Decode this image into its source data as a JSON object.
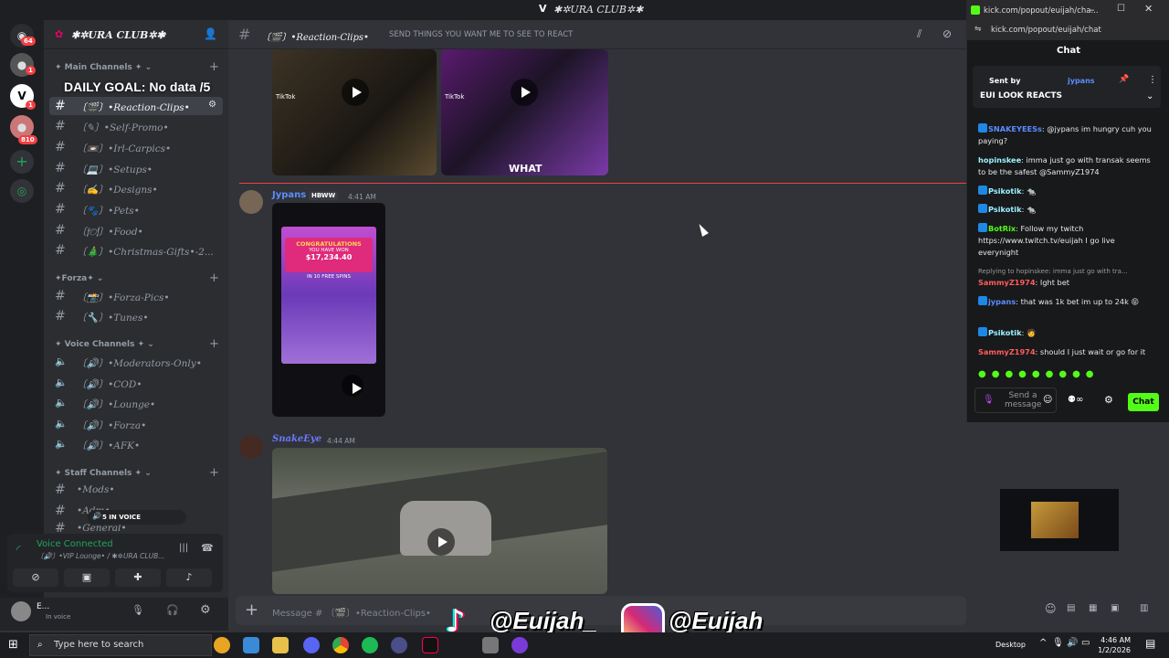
{
  "window": {
    "title": "✱✲URA CLUB✲✱"
  },
  "server": {
    "name": "✱✲URA CLUB✲✱",
    "rail_badges": [
      "64",
      "1",
      "1",
      "810"
    ]
  },
  "overlay": {
    "goal_text": "DAILY GOAL: No data  /5"
  },
  "categories": {
    "main": "✦ Main Channels ✦ ⌄",
    "forza": "✦Forza✦ ⌄",
    "voice": "✦ Voice Channels ✦ ⌄",
    "staff": "✦ Staff Channels ✦ ⌄"
  },
  "channels": [
    {
      "label": "〔🎬〕•Reaction-Clips•"
    },
    {
      "label": "〔✎〕•Self-Promo•"
    },
    {
      "label": "〔📼〕•Irl-Carpics•"
    },
    {
      "label": "〔💻〕•Setups•"
    },
    {
      "label": "〔✍〕•Designs•"
    },
    {
      "label": "〔🐾〕•Pets•"
    },
    {
      "label": "〔🍽〕•Food•"
    },
    {
      "label": "〔🎄〕•Christmas-Gifts•-2..."
    },
    {
      "label": "〔📸〕•Forza-Pics•"
    },
    {
      "label": "〔🔧〕•Tunes•"
    },
    {
      "label": "〔🔊〕•Moderators-Only•"
    },
    {
      "label": "〔🔊〕•COD•"
    },
    {
      "label": "〔🔊〕•Lounge•"
    },
    {
      "label": "〔🔊〕•Forza•"
    },
    {
      "label": "〔🔊〕•AFK•"
    },
    {
      "label": "•Mods•"
    },
    {
      "label": "•Adm•"
    },
    {
      "label": "•General•"
    }
  ],
  "voice": {
    "chip": "5 IN VOICE",
    "connected": "Voice Connected",
    "location": "〔🔊〕•VIP Lounge• / ✱✲URA CLUB...",
    "user_name": "E...",
    "user_status": "In voice"
  },
  "channel_header": {
    "name": "〔🎬〕•Reaction-Clips•",
    "topic": "SEND THINGS YOU WANT ME TO SEE TO REACT"
  },
  "messages": [
    {
      "author": "Jypans",
      "tag": "HBWW",
      "time": "4:41 AM",
      "image_text": [
        "CONGRATULATIONS",
        "YOU HAVE WON",
        "$17,234.40",
        "IN 10 FREE SPINS"
      ]
    },
    {
      "author": "SnakeEye",
      "time": "4:44 AM"
    }
  ],
  "top_clips": {
    "tiktok": "TikTok",
    "caption": "WHAT"
  },
  "message_input": {
    "placeholder": "Message # 〔🎬〕•Reaction-Clips•"
  },
  "social_overlay": {
    "tiktok": "@Euijah_",
    "instagram": "@Euijah"
  },
  "kick": {
    "window_title": "kick.com/popout/euijah/cha...",
    "url": "kick.com/popout/euijah/chat",
    "chat_title": "Chat",
    "pinned_by": "Sent by",
    "pinned_user": "jypans",
    "pinned_text": "EUI LOOK REACTS",
    "messages": [
      {
        "user": "SNAKEYEESs",
        "color": "#5b8dff",
        "text": "@jypans im hungry cuh you paying?"
      },
      {
        "user": "hopinskee",
        "color": "#9bf2ff",
        "text": "imma just go with transak seems to be the safest @SammyZ1974"
      },
      {
        "user": "Psikotik",
        "color": "#9bf2ff",
        "text": ""
      },
      {
        "user": "Psikotik",
        "color": "#9bf2ff",
        "text": ""
      },
      {
        "user": "BotRix",
        "color": "#53fc18",
        "text": "Follow my twitch https://www.twitch.tv/euijah I go live everynight"
      },
      {
        "user": "",
        "color": "#999",
        "text": "Replying to hopinskee: imma just go with tra..."
      },
      {
        "user": "SammyZ1974",
        "color": "#ff5c5c",
        "text": "Ight bet"
      },
      {
        "user": "jypans",
        "color": "#5b8dff",
        "text": "that was 1k bet im up to 24k 😝"
      },
      {
        "user": "Psikotik",
        "color": "#9bf2ff",
        "text": ""
      },
      {
        "user": "SammyZ1974",
        "color": "#ff5c5c",
        "text": "should I just wait or go for it"
      }
    ],
    "input_placeholder": "Send a message",
    "chat_button": "Chat"
  },
  "taskbar": {
    "search_placeholder": "Type here to search",
    "desktop": "Desktop",
    "time": "4:46 AM",
    "date": "1/2/2026"
  },
  "colors": {
    "accent_green": "#53fc18",
    "discord_bg": "#313338",
    "sidebar_bg": "#2b2d31"
  }
}
